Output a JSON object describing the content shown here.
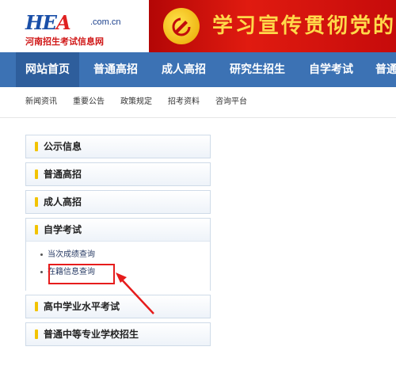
{
  "header": {
    "logo_mark_left": "HE",
    "logo_mark_o": "A",
    "logo_domain": ".com.cn",
    "logo_subtitle": "河南招生考试信息网",
    "banner_text": "学习宣传贯彻党的"
  },
  "main_nav": {
    "items": [
      "网站首页",
      "普通高招",
      "成人高招",
      "研究生招生",
      "自学考试",
      "普通"
    ]
  },
  "sub_nav": {
    "items": [
      "新闻资讯",
      "重要公告",
      "政策规定",
      "招考资料",
      "咨询平台"
    ]
  },
  "menu": {
    "items": [
      "公示信息",
      "普通高招",
      "成人高招",
      "自学考试",
      "高中学业水平考试",
      "普通中等专业学校招生"
    ],
    "expanded_sub": [
      "当次成绩查询",
      "在籍信息查询"
    ]
  },
  "colors": {
    "nav_blue": "#3c72b4",
    "banner_red": "#d0140c",
    "marker_yellow": "#f2c300",
    "annotation_red": "#e61c1c"
  }
}
